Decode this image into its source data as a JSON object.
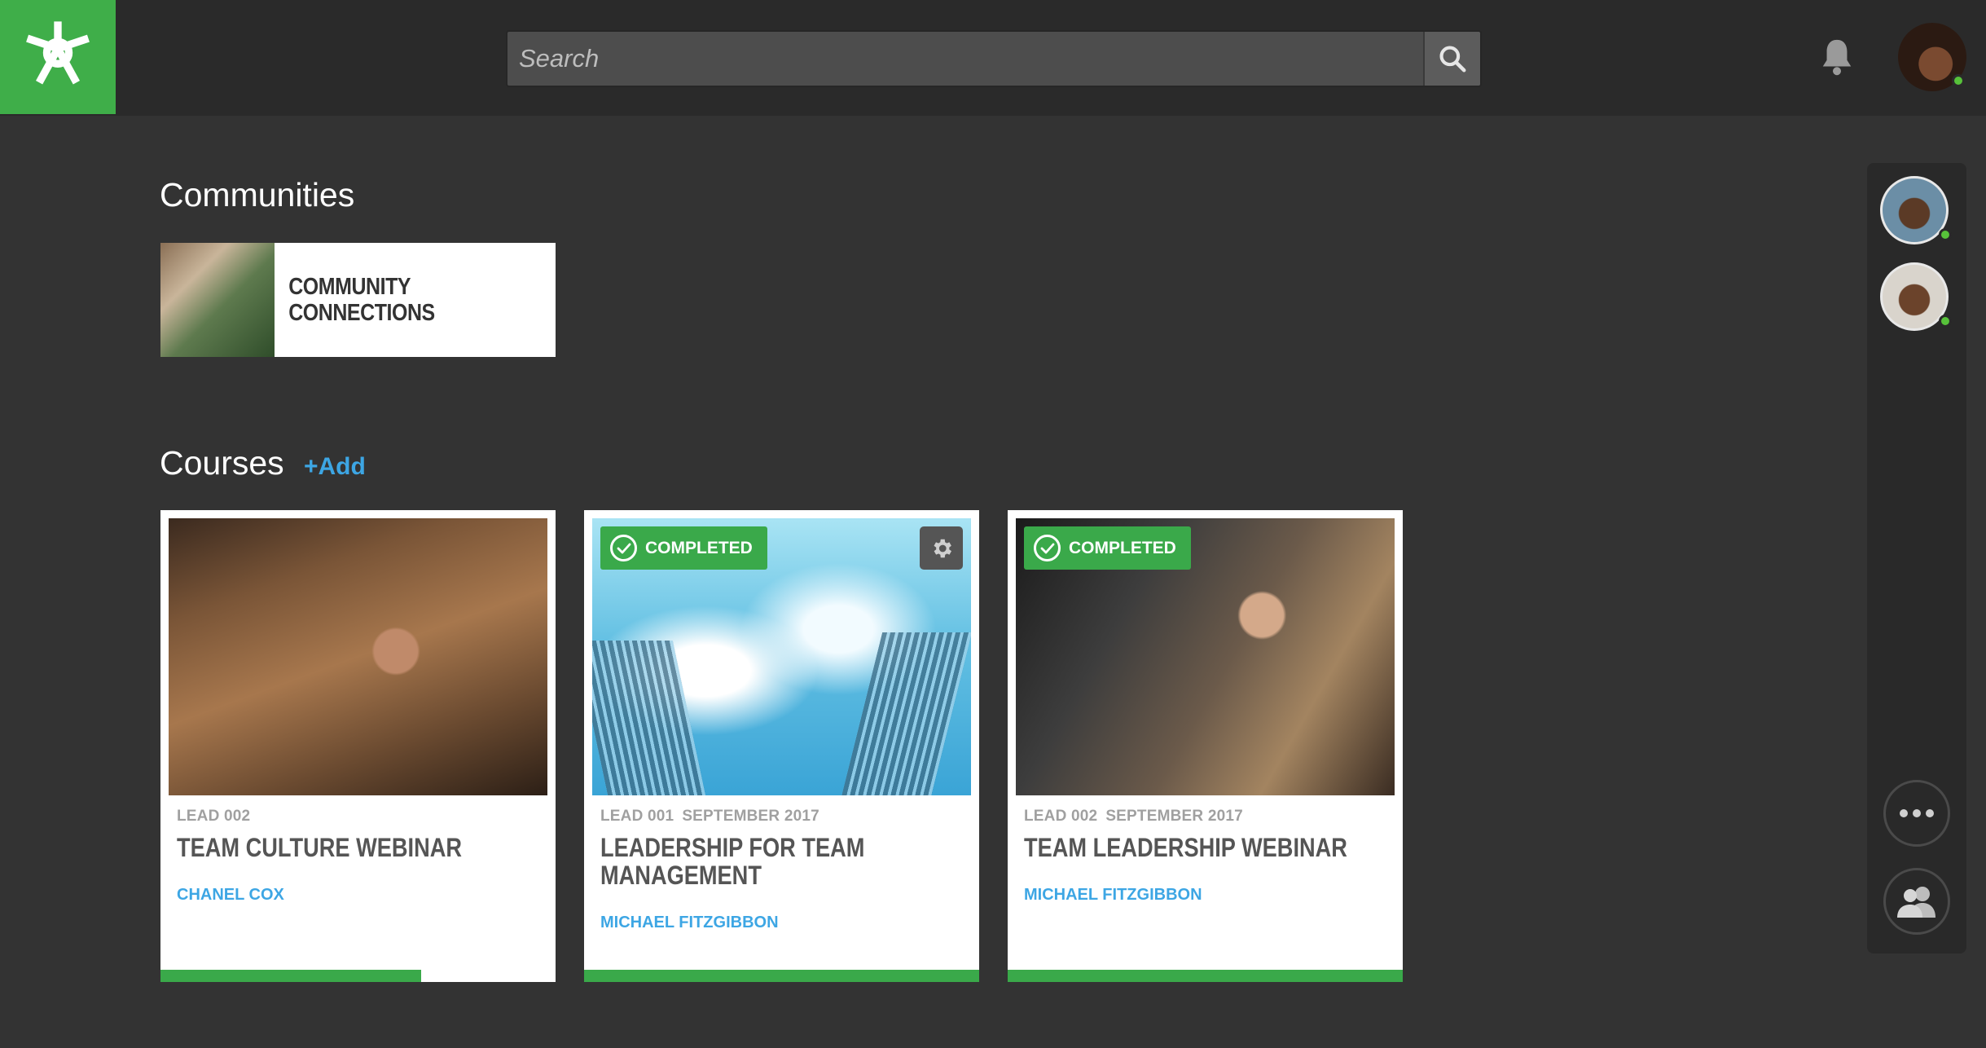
{
  "header": {
    "logo_name": "app-logo",
    "search": {
      "placeholder": "Search",
      "value": ""
    },
    "icons": [
      "search-icon",
      "bell-icon"
    ],
    "user": {
      "status": "online",
      "status_color": "#57c23a"
    }
  },
  "communities": {
    "title": "Communities",
    "items": [
      {
        "label": "COMMUNITY\nCONNECTIONS"
      }
    ]
  },
  "courses": {
    "title": "Courses",
    "add_label": "+Add",
    "items": [
      {
        "code": "LEAD 002",
        "date": "",
        "title": "TEAM CULTURE WEBINAR",
        "author": "CHANEL COX",
        "completed": false,
        "progress": 0.66
      },
      {
        "code": "LEAD 001",
        "date": "SEPTEMBER 2017",
        "title": "LEADERSHIP FOR TEAM MANAGEMENT",
        "author": "MICHAEL FITZGIBBON",
        "completed": true,
        "badge": "COMPLETED",
        "progress": 1.0
      },
      {
        "code": "LEAD 002",
        "date": "SEPTEMBER 2017",
        "title": "TEAM LEADERSHIP WEBINAR",
        "author": "MICHAEL FITZGIBBON",
        "completed": true,
        "badge": "COMPLETED",
        "progress": 1.0
      }
    ]
  },
  "colors": {
    "accent_green": "#3fae49",
    "link_blue": "#3da6e4",
    "background": "#333333"
  },
  "right_rail": {
    "icons": [
      "more-icon",
      "group-icon"
    ]
  }
}
